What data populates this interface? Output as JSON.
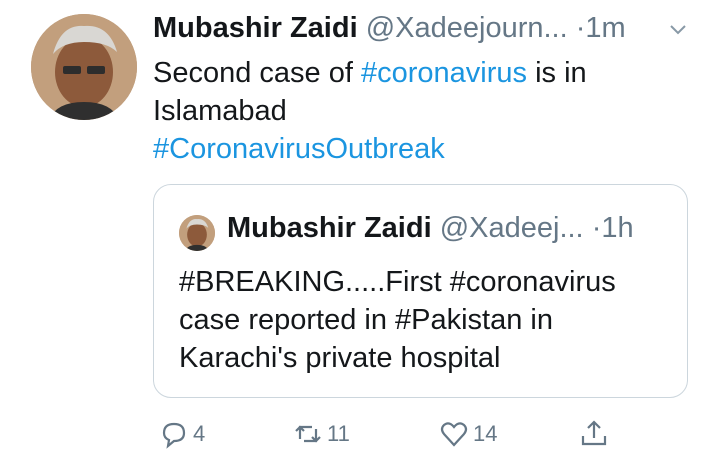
{
  "tweet": {
    "author_name": "Mubashir Zaidi",
    "handle": "@Xadeejourn...",
    "separator": "·",
    "time": "1m",
    "text_parts": [
      "Second case of ",
      "#coronavirus",
      " is in",
      "Islamabad",
      "#CoronavirusOutbreak"
    ]
  },
  "quoted": {
    "author_name": "Mubashir Zaidi",
    "handle": "@Xadeej...",
    "separator": "·",
    "time": "1h",
    "lines": [
      "#BREAKING.....First #coronavirus",
      "case reported in #Pakistan in",
      "Karachi's private hospital"
    ]
  },
  "actions": {
    "reply_count": "4",
    "retweet_count": "11",
    "like_count": "14"
  },
  "colors": {
    "link": "#1b95e0",
    "muted": "#657786",
    "border": "#ccd6dd"
  },
  "icons": [
    "chevron-down-icon",
    "reply-icon",
    "retweet-icon",
    "like-icon",
    "share-icon"
  ]
}
